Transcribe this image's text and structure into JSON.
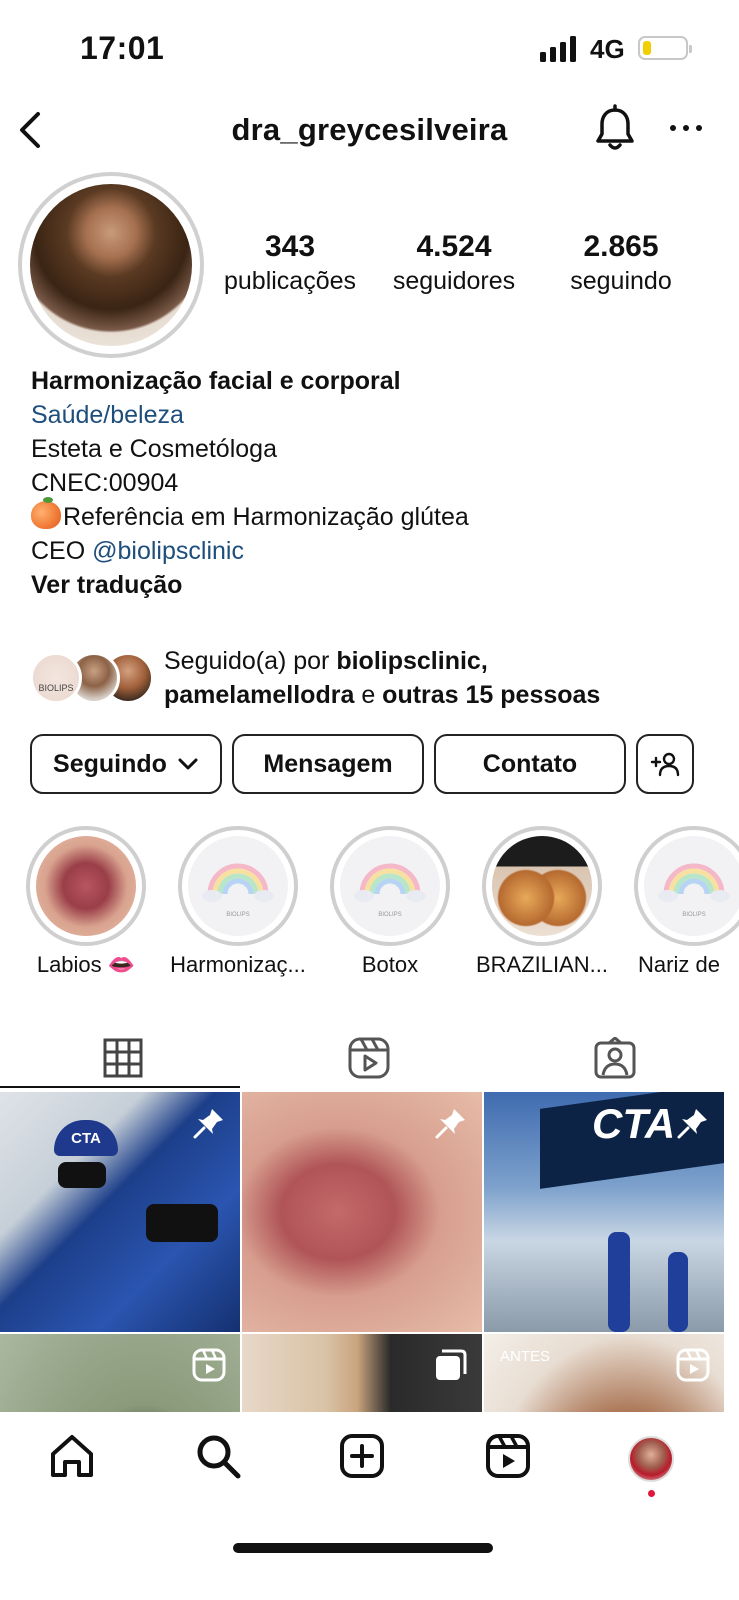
{
  "status_bar": {
    "time": "17:01",
    "network": "4G"
  },
  "header": {
    "username": "dra_greycesilveira"
  },
  "stats": [
    {
      "value": "343",
      "label": "publicações"
    },
    {
      "value": "4.524",
      "label": "seguidores"
    },
    {
      "value": "2.865",
      "label": "seguindo"
    }
  ],
  "bio": {
    "name": "Harmonização facial e corporal",
    "category": "Saúde/beleza",
    "line1": "Esteta e Cosmetóloga",
    "line2": "CNEC:00904",
    "line3": "Referência em Harmonização glútea",
    "ceo_prefix": "CEO",
    "ceo_handle": "@biolipsclinic",
    "translate": "Ver tradução"
  },
  "followed_by": {
    "prefix": "Seguido(a) por",
    "user1": "biolipsclinic,",
    "user2": "pamelamellodra",
    "conj": "e",
    "others": "outras 15 pessoas",
    "avatar_text": "BIOLIPS"
  },
  "buttons": {
    "following": "Seguindo",
    "message": "Mensagem",
    "contact": "Contato"
  },
  "highlights": [
    {
      "label": "Labios 👄"
    },
    {
      "label": "Harmonizaç..."
    },
    {
      "label": "Botox"
    },
    {
      "label": "BRAZILIAN..."
    },
    {
      "label": "Nariz de"
    }
  ],
  "highlight_logo_text": "BIOLIPS",
  "posts": [
    {
      "text": "CTA",
      "badge": "pin-icon"
    },
    {
      "text": "",
      "badge": "pin-icon"
    },
    {
      "text": "CTA",
      "badge": "pin-icon"
    },
    {
      "text": "",
      "badge": "reels-icon"
    },
    {
      "text": "",
      "badge": "carousel-icon"
    },
    {
      "text": "ANTES",
      "badge": "reels-icon"
    }
  ],
  "colors": {
    "link": "#1e4e7c",
    "notification_dot": "#e0163b"
  }
}
